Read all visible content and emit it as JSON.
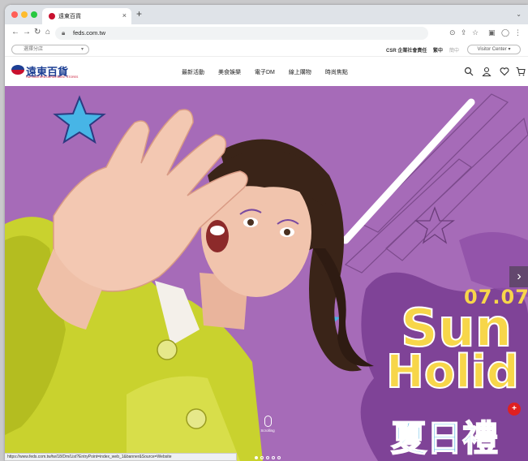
{
  "browser": {
    "tab_title": "遠東百貨",
    "tab_close": "×",
    "new_tab": "+",
    "url": "feds.com.tw",
    "status_url": "https://www.feds.com.tw/tw/18/Dm/List?EntryPoint=index_web_1&banner&Source=Website"
  },
  "utility": {
    "store_placeholder": "選擇分店",
    "links": [
      "CSR 企業社會責任",
      "繁中",
      "簡中"
    ],
    "visitor_label": "Visitor Center"
  },
  "header": {
    "logo_text": "遠東百貨",
    "logo_sub": "FAR EASTERN DEPARTMENT STORES",
    "nav": [
      "最新活動",
      "美食娛樂",
      "電子DM",
      "線上購物",
      "時尚焦點"
    ]
  },
  "hero": {
    "date": "07.07",
    "headline_1": "Sun",
    "headline_2": "Holid",
    "headline_cn": "夏日禮",
    "scroll_label": "Scrolling",
    "slide_count": 5,
    "active_slide": 1,
    "next_arrow": "›",
    "plus_badge": "+"
  },
  "colors": {
    "hero_bg": "#a66bb8",
    "accent_yellow": "#f7d64a",
    "accent_blue": "#39a9e0",
    "brand_blue": "#1c3f94",
    "brand_red": "#c8102e"
  }
}
